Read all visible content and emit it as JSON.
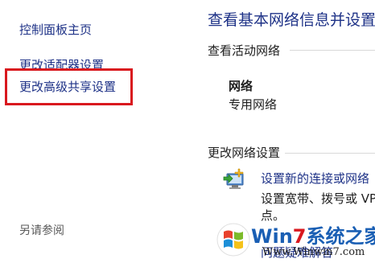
{
  "sidebar": {
    "home_link": "控制面板主页",
    "adapter_link": "更改适配器设置",
    "sharing_link": "更改高级共享设置",
    "see_also": "另请参阅"
  },
  "main": {
    "title": "查看基本网络信息并设置",
    "active_networks_heading": "查看活动网络",
    "network_name": "网络",
    "network_type": "专用网络",
    "change_settings_heading": "更改网络设置",
    "setup_link": "设置新的连接或网络",
    "setup_desc_line1": "设置宽带、拨号或 VPN",
    "setup_desc_line2": "点。",
    "troubleshoot_link": "问题疑难解答"
  },
  "watermark": {
    "logo_text_main": "Win",
    "logo_text_accent": "7",
    "logo_text_rest": "系统之家",
    "url": "Www.Winwin7.com"
  },
  "colors": {
    "link": "#1e3287",
    "highlight": "#d9181e"
  }
}
